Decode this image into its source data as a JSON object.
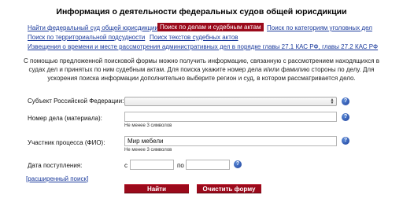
{
  "page": {
    "title": "Информация о деятельности федеральных судов общей юрисдикции"
  },
  "nav": {
    "items": [
      "Найти федеральный суд общей юрисдикции",
      "Поиск по делам и судебным актам",
      "Поиск по категориям уголовных дел",
      "Поиск по территориальной подсудности",
      "Поиск текстов судебных актов",
      "Извещения о времени и месте рассмотрения административных дел в порядке главы 27.1 КАС РФ, главы 27.2 КАС РФ"
    ]
  },
  "info_text": "С помощью предложенной поисковой формы можно получить информацию, связанную с рассмотрением находящихся в судах дел и принятых по ним судебным актам. Для поиска укажите номер дела и/или фамилию стороны по делу. Для ускорения поиска информации дополнительно выберите регион и суд, в котором рассматривается дело.",
  "form": {
    "region_label": "Субъект Российской Федерации:",
    "region_value": "",
    "case_number_label": "Номер дела (материала):",
    "case_number_value": "",
    "case_number_hint": "Не менее 3 символов",
    "participant_label": "Участник процесса (ФИО):",
    "participant_value": "Мир мебели",
    "participant_hint": "Не менее 3 символов",
    "date_label": "Дата поступления:",
    "date_from_label": "с",
    "date_from_value": "",
    "date_to_label": "по",
    "date_to_value": "",
    "help_symbol": "?",
    "extended_open": "[",
    "extended_link": "расширенный поиск",
    "extended_close": "]",
    "search_button": "Найти",
    "clear_button": "Очистить форму"
  },
  "colors": {
    "accent": "#9b0a1b",
    "link": "#1a3a9c",
    "help_icon": "#2a55b8"
  },
  "icons": {
    "help": "help-question-icon",
    "select_arrows": "select-arrows-icon"
  }
}
